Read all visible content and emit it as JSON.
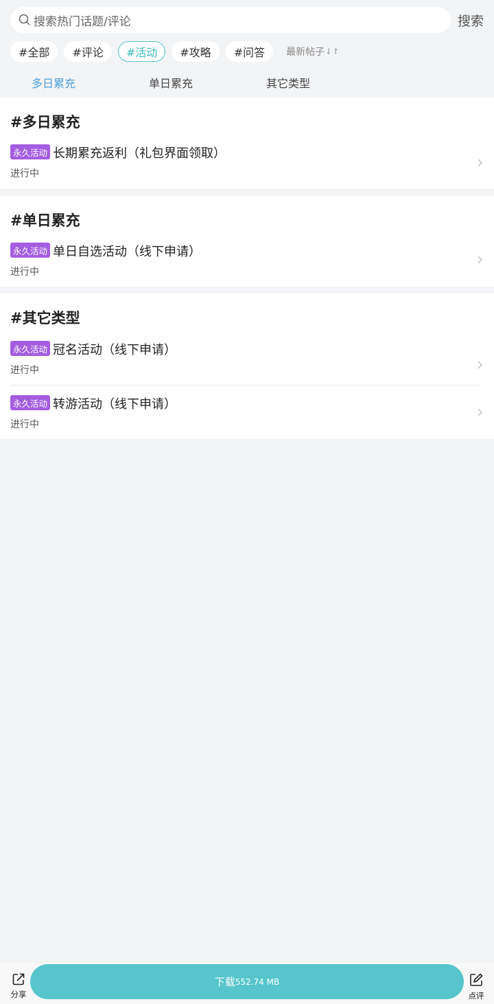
{
  "search": {
    "placeholder": "搜索热门话题/评论",
    "button": "搜索"
  },
  "tags": [
    "#全部",
    "#评论",
    "#活动",
    "#攻略",
    "#问答"
  ],
  "active_tag": "#活动",
  "sort": {
    "label": "最新帖子",
    "icon": "sort-arrows-icon"
  },
  "subtabs": [
    "多日累充",
    "单日累充",
    "其它类型"
  ],
  "sections": [
    {
      "title": "#多日累充",
      "items": [
        {
          "badge": "永久活动",
          "title": "长期累充返利（礼包界面领取）",
          "status": "进行中"
        }
      ]
    },
    {
      "title": "#单日累充",
      "items": [
        {
          "badge": "永久活动",
          "title": "单日自选活动（线下申请）",
          "status": "进行中"
        }
      ]
    },
    {
      "title": "#其它类型",
      "items": [
        {
          "badge": "永久活动",
          "title": "冠名活动（线下申请）",
          "status": "进行中"
        },
        {
          "badge": "永久活动",
          "title": "转游活动（线下申请）",
          "status": "进行中"
        }
      ]
    }
  ],
  "bottom": {
    "share": "分享",
    "download_label": "下载",
    "download_size": "552.74 MB",
    "review": "点评"
  },
  "colors": {
    "accent": "#56c5cc",
    "badge": "#a45de0",
    "active_subtab": "#4b9fdc"
  }
}
